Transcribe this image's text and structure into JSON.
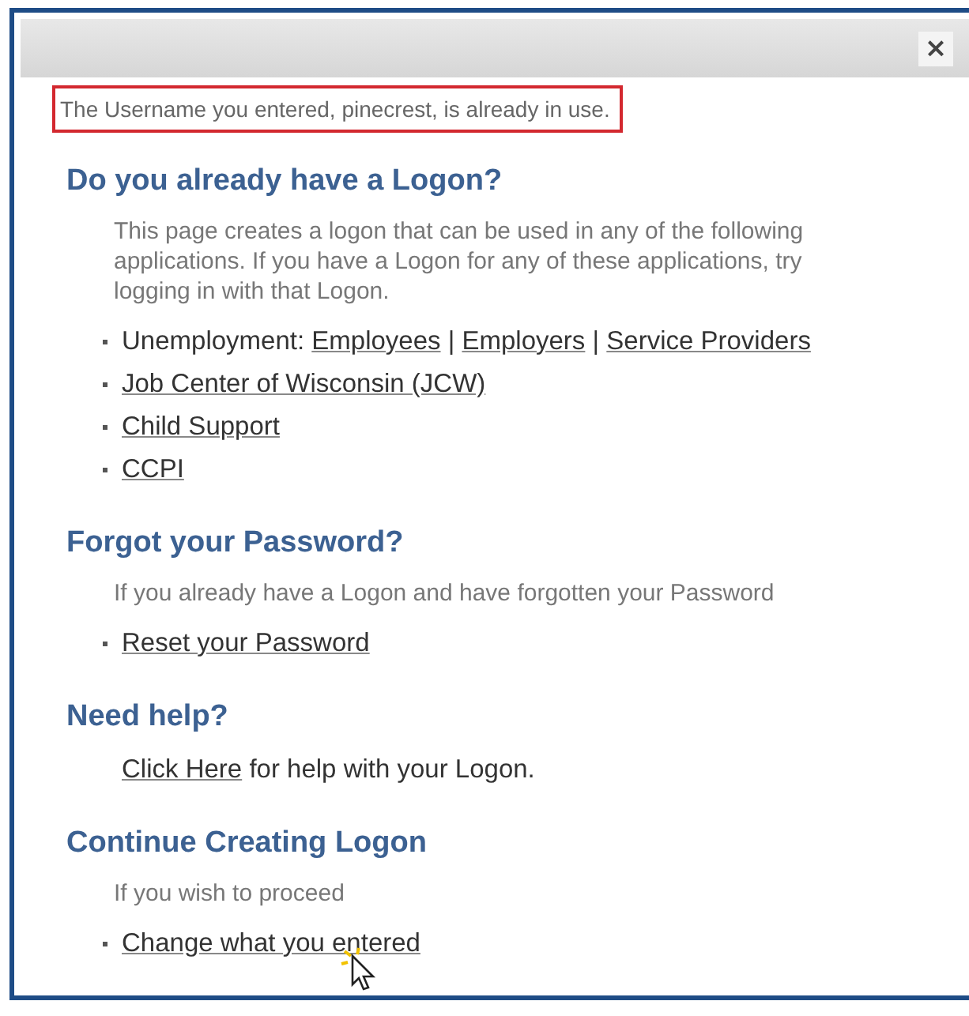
{
  "close_button": {
    "label": "×"
  },
  "error": "The Username you entered, pinecrest, is already in use.",
  "sections": [
    {
      "heading": "Do you already have a Logon?",
      "intro": "This page creates a logon that can be used in any of the following applications. If you have a Logon for any of these applications, try logging in with that Logon.",
      "items": [
        {
          "kind": "bullet",
          "parts": [
            {
              "text": "Unemployment: ",
              "link": false
            },
            {
              "text": "Employees",
              "link": true
            },
            {
              "text": " | ",
              "link": false
            },
            {
              "text": "Employers",
              "link": true
            },
            {
              "text": " | ",
              "link": false
            },
            {
              "text": "Service Providers",
              "link": true
            }
          ]
        },
        {
          "kind": "bullet",
          "parts": [
            {
              "text": "Job Center of Wisconsin (JCW)",
              "link": true
            }
          ]
        },
        {
          "kind": "bullet",
          "parts": [
            {
              "text": "Child Support",
              "link": true
            }
          ]
        },
        {
          "kind": "bullet",
          "parts": [
            {
              "text": "CCPI",
              "link": true
            }
          ]
        }
      ]
    },
    {
      "heading": "Forgot your Password?",
      "intro": "If you already have a Logon and have forgotten your Password",
      "items": [
        {
          "kind": "bullet",
          "parts": [
            {
              "text": "Reset your Password",
              "link": true
            }
          ]
        }
      ]
    },
    {
      "heading": "Need help?",
      "items": [
        {
          "kind": "plain",
          "parts": [
            {
              "text": "Click Here",
              "link": true
            },
            {
              "text": " for help with your Logon.",
              "link": false
            }
          ]
        }
      ]
    },
    {
      "heading": "Continue Creating Logon",
      "intro": "If you wish to proceed",
      "items": [
        {
          "kind": "bullet",
          "cursor": true,
          "parts": [
            {
              "text": "Change what you entered",
              "link": true
            }
          ]
        }
      ]
    }
  ]
}
